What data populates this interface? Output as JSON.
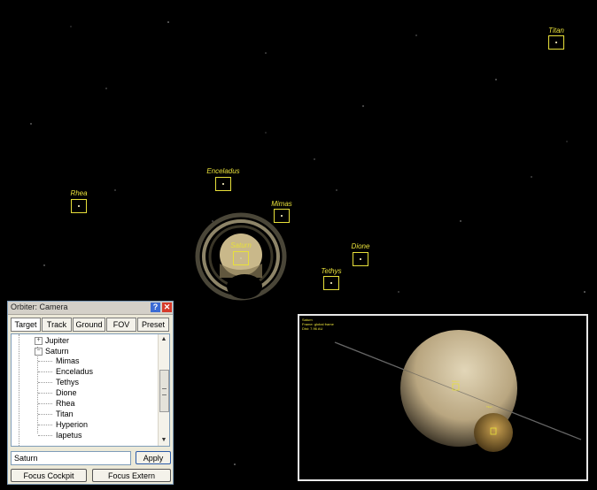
{
  "moons": [
    {
      "name": "Titan",
      "label": "Titan"
    },
    {
      "name": "Enceladus",
      "label": "Enceladus"
    },
    {
      "name": "Rhea",
      "label": "Rhea"
    },
    {
      "name": "Mimas",
      "label": "Mimas"
    },
    {
      "name": "Dione",
      "label": "Dione"
    },
    {
      "name": "Tethys",
      "label": "Tethys"
    },
    {
      "name": "Saturn",
      "label": "Saturn"
    }
  ],
  "dialog": {
    "title": "Orbiter: Camera",
    "help_icon": "?",
    "close_icon": "✕",
    "tabs": [
      "Target",
      "Track",
      "Ground",
      "FOV",
      "Preset"
    ],
    "active_tab": "Target",
    "tree": {
      "jupiter": "Jupiter",
      "saturn": "Saturn",
      "saturn_children": [
        "Mimas",
        "Enceladus",
        "Tethys",
        "Dione",
        "Rhea",
        "Titan",
        "Hyperion",
        "Iapetus"
      ]
    },
    "target_value": "Saturn",
    "apply_label": "Apply",
    "focus_cockpit_label": "Focus Cockpit",
    "focus_extern_label": "Focus Extern"
  },
  "inset": {
    "info_lines": [
      "Saturn",
      "Frame: global frame",
      "Dist: 7.96 AU"
    ],
    "markers": [
      "Saturn",
      "Titan"
    ]
  },
  "colors": {
    "label": "#e8e03a",
    "background": "#000000",
    "dialog_bg": "#ece9d8"
  }
}
